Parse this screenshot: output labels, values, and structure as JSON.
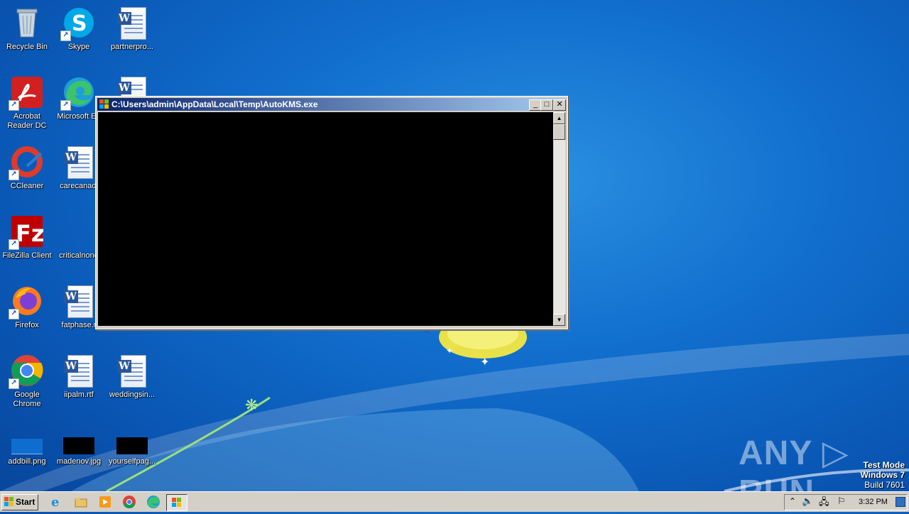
{
  "desktop": {
    "icons": [
      {
        "id": "recycle",
        "label": "Recycle Bin"
      },
      {
        "id": "skype",
        "label": "Skype"
      },
      {
        "id": "partner",
        "label": "partnerpro..."
      },
      {
        "id": "acrobat",
        "label": "Acrobat Reader DC"
      },
      {
        "id": "edge",
        "label": "Microsoft Ed"
      },
      {
        "id": "ccleaner",
        "label": "CCleaner"
      },
      {
        "id": "carecana",
        "label": "carecanadi"
      },
      {
        "id": "filezilla",
        "label": "FileZilla Client"
      },
      {
        "id": "critical",
        "label": "criticalnone"
      },
      {
        "id": "firefox",
        "label": "Firefox"
      },
      {
        "id": "fatphase",
        "label": "fatphase.r"
      },
      {
        "id": "chrome",
        "label": "Google Chrome"
      },
      {
        "id": "iipalm",
        "label": "iipalm.rtf"
      },
      {
        "id": "weddings",
        "label": "weddingsin..."
      },
      {
        "id": "addbill",
        "label": "addbill.png"
      },
      {
        "id": "madenov",
        "label": "madenov.jpg"
      },
      {
        "id": "yourself",
        "label": "yourselfpag..."
      }
    ]
  },
  "console": {
    "title": "C:\\Users\\admin\\AppData\\Local\\Temp\\AutoKMS.exe",
    "minimize": "_",
    "maximize": "□",
    "close": "✕"
  },
  "watermark": {
    "text": "ANY ▷ RUN"
  },
  "testmode": {
    "line1": "Test Mode",
    "line2": "Windows 7",
    "line3": "Build 7601"
  },
  "taskbar": {
    "start_label": "Start",
    "clock": "3:32 PM",
    "pinned": [
      "ie-icon",
      "explorer-icon",
      "media-player-icon",
      "chrome-icon",
      "edge-icon",
      "autokms-icon"
    ]
  }
}
